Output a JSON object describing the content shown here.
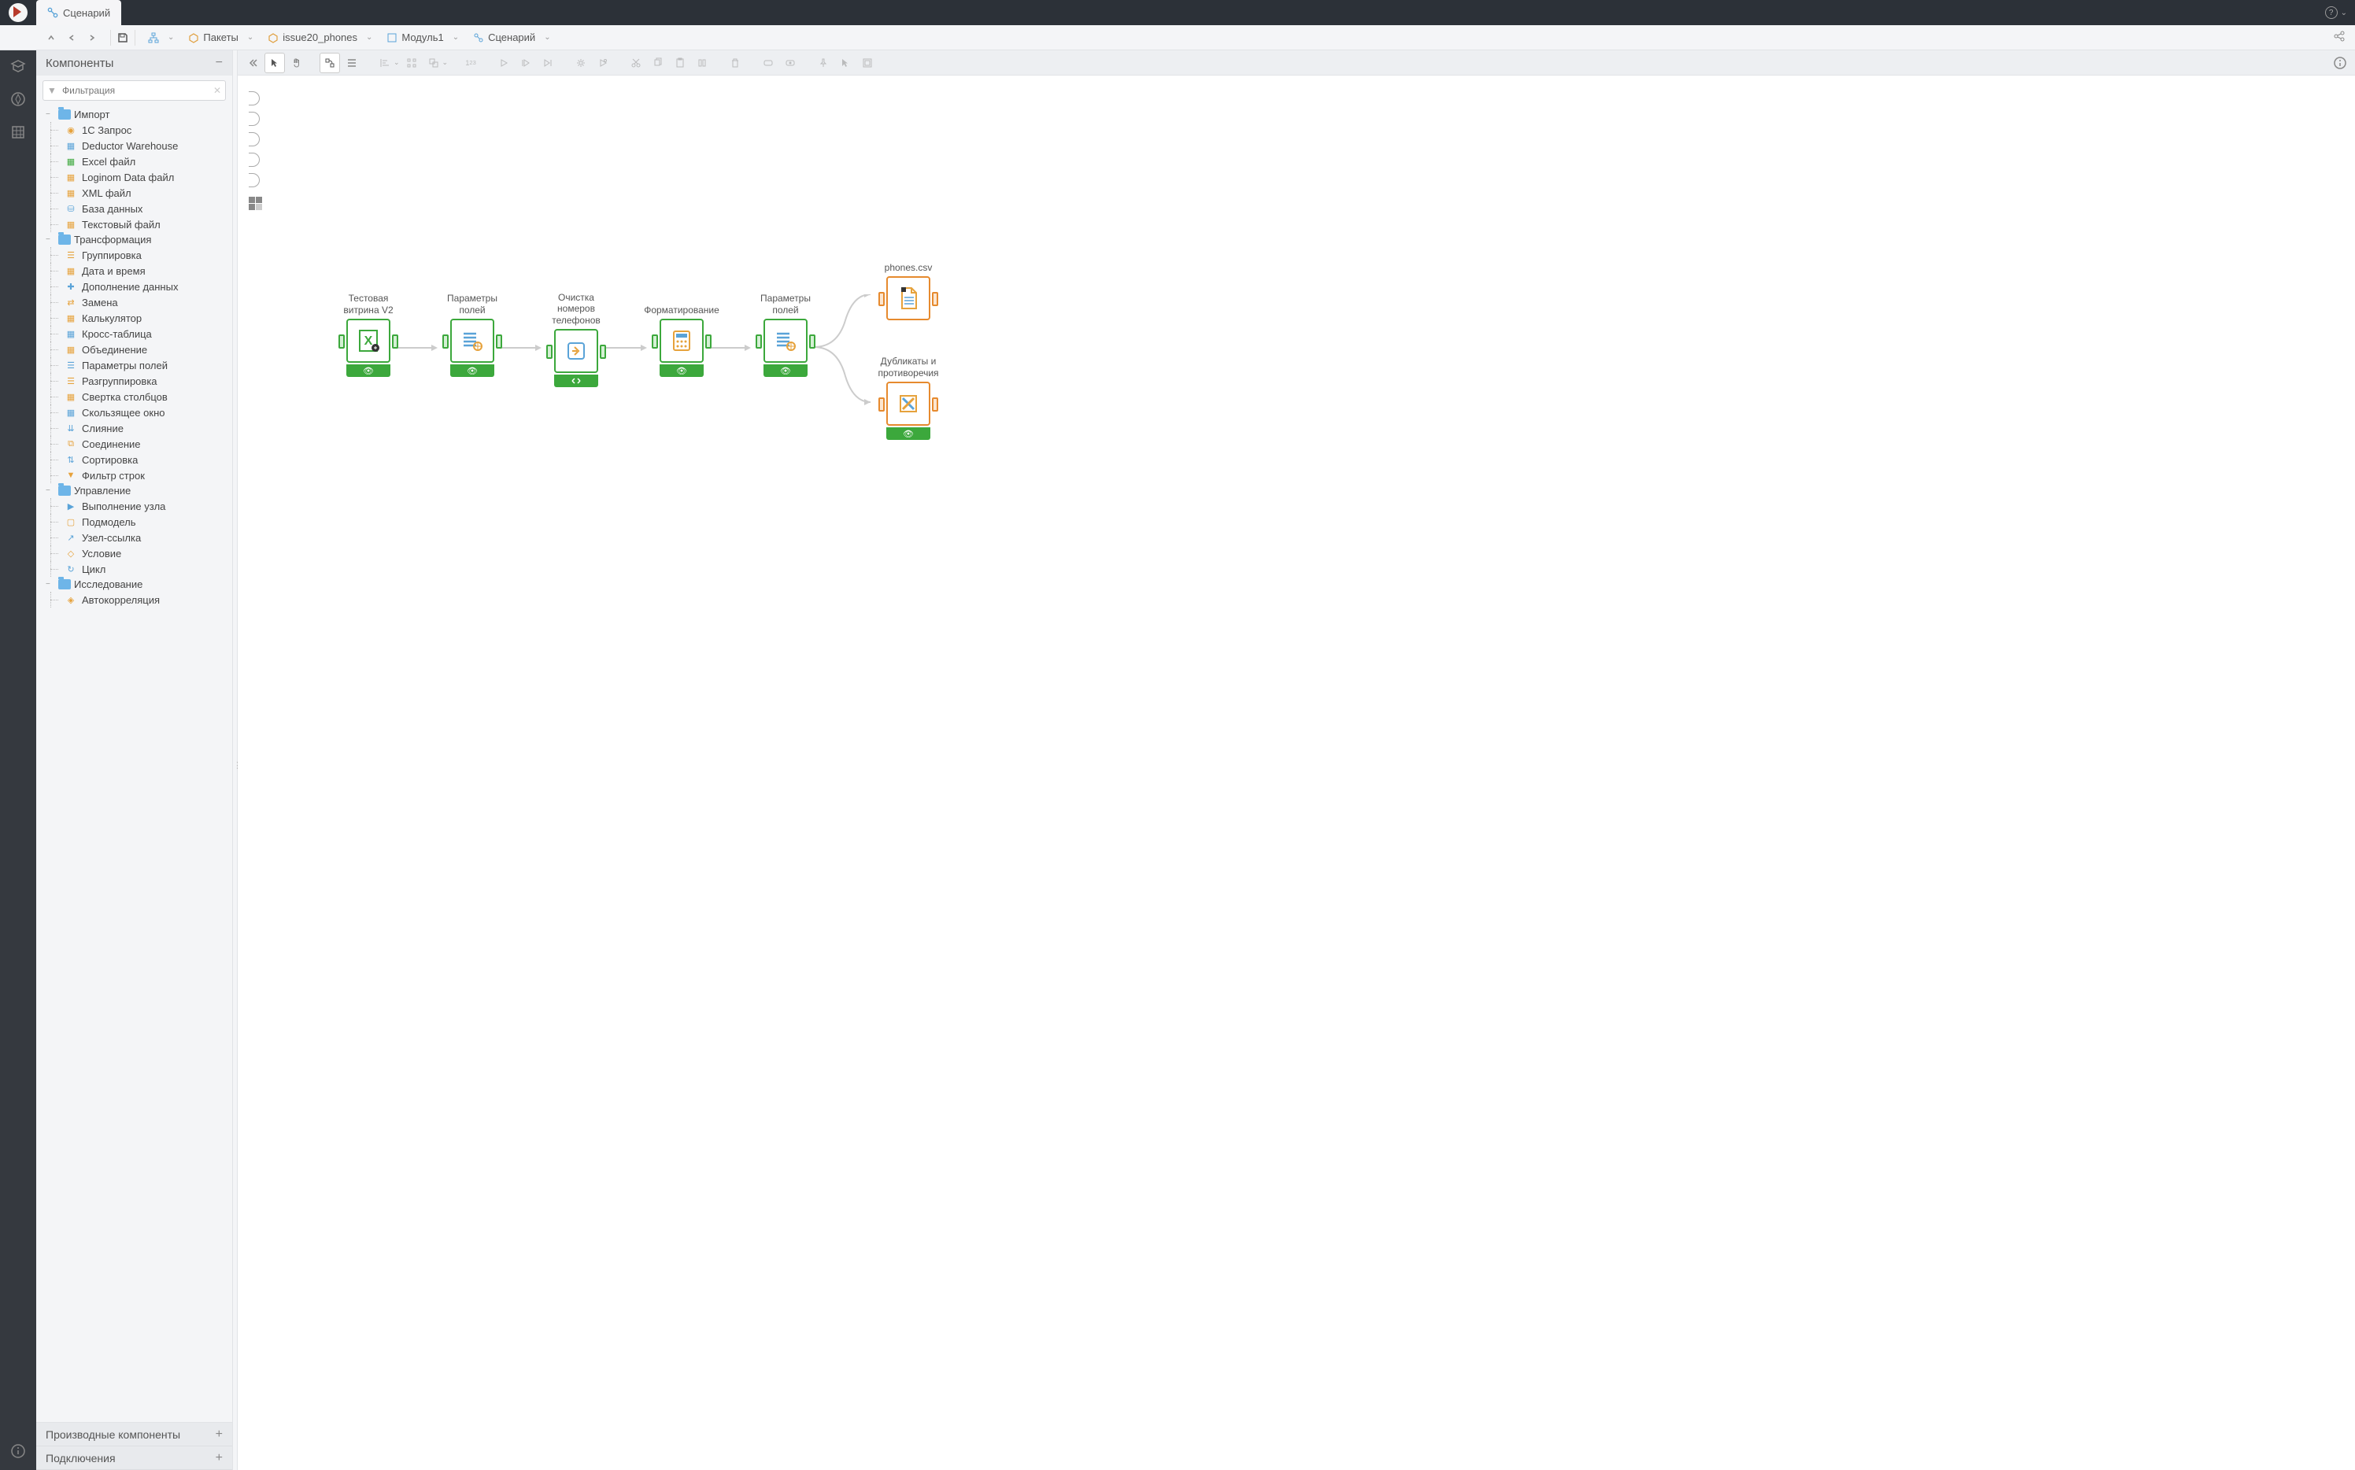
{
  "titlebar": {
    "tab": "Сценарий"
  },
  "help_chevron": "⌄",
  "breadcrumb": {
    "packages": "Пакеты",
    "project": "issue20_phones",
    "module": "Модуль1",
    "scenario": "Сценарий"
  },
  "sidebar": {
    "title": "Компоненты",
    "filter_placeholder": "Фильтрация",
    "folders": {
      "import": {
        "label": "Импорт",
        "items": [
          "1С Запрос",
          "Deductor Warehouse",
          "Excel файл",
          "Loginom Data файл",
          "XML файл",
          "База данных",
          "Текстовый файл"
        ]
      },
      "transform": {
        "label": "Трансформация",
        "items": [
          "Группировка",
          "Дата и время",
          "Дополнение данных",
          "Замена",
          "Калькулятор",
          "Кросс-таблица",
          "Объединение",
          "Параметры полей",
          "Разгруппировка",
          "Свертка столбцов",
          "Скользящее окно",
          "Слияние",
          "Соединение",
          "Сортировка",
          "Фильтр строк"
        ]
      },
      "control": {
        "label": "Управление",
        "items": [
          "Выполнение узла",
          "Подмодель",
          "Узел-ссылка",
          "Условие",
          "Цикл"
        ]
      },
      "research": {
        "label": "Исследование",
        "items": [
          "Автокорреляция"
        ]
      }
    },
    "derived_panel": "Производные компоненты",
    "connections_panel": "Подключения"
  },
  "nodes": {
    "n1": "Тестовая витрина V2",
    "n2": "Параметры полей",
    "n3": "Очистка номеров телефонов",
    "n4": "Форматирование",
    "n5": "Параметры полей",
    "n6": "phones.csv",
    "n7": "Дубликаты и противоречия"
  }
}
